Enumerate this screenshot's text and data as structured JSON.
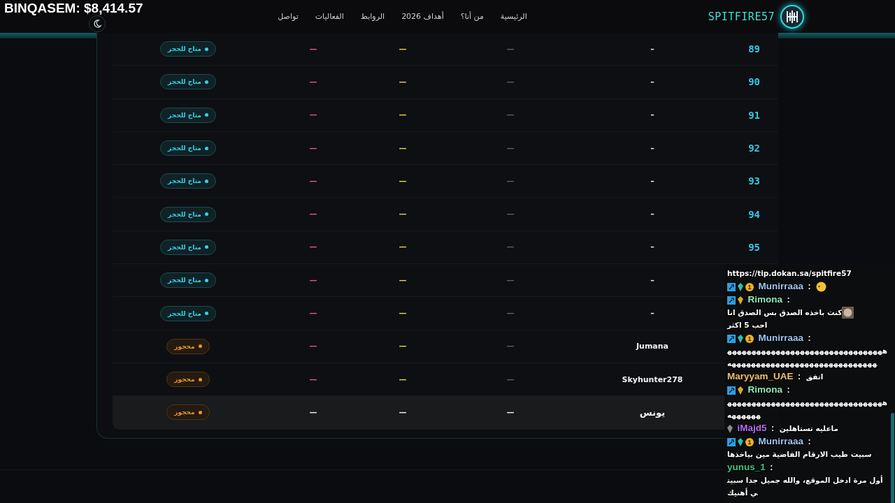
{
  "overlay": {
    "balance": "BINQASEM: $8,414.57"
  },
  "nav": {
    "brand": "SPITFIRE57",
    "links": [
      "الرئيسية",
      "من أنا؟",
      "أهداف 2026",
      "الروابط",
      "الفعاليات",
      "تواصل"
    ]
  },
  "table": {
    "rows": [
      {
        "number": "89",
        "name": "–",
        "cells": [
          "—",
          "—",
          "—"
        ],
        "status": {
          "kind": "available",
          "label": "متاح للحجز"
        },
        "hovered": false
      },
      {
        "number": "90",
        "name": "–",
        "cells": [
          "—",
          "—",
          "—"
        ],
        "status": {
          "kind": "available",
          "label": "متاح للحجز"
        },
        "hovered": false
      },
      {
        "number": "91",
        "name": "–",
        "cells": [
          "—",
          "—",
          "—"
        ],
        "status": {
          "kind": "available",
          "label": "متاح للحجز"
        },
        "hovered": false
      },
      {
        "number": "92",
        "name": "–",
        "cells": [
          "—",
          "—",
          "—"
        ],
        "status": {
          "kind": "available",
          "label": "متاح للحجز"
        },
        "hovered": false
      },
      {
        "number": "93",
        "name": "–",
        "cells": [
          "—",
          "—",
          "—"
        ],
        "status": {
          "kind": "available",
          "label": "متاح للحجز"
        },
        "hovered": false
      },
      {
        "number": "94",
        "name": "–",
        "cells": [
          "—",
          "—",
          "—"
        ],
        "status": {
          "kind": "available",
          "label": "متاح للحجز"
        },
        "hovered": false
      },
      {
        "number": "95",
        "name": "–",
        "cells": [
          "—",
          "—",
          "—"
        ],
        "status": {
          "kind": "available",
          "label": "متاح للحجز"
        },
        "hovered": false
      },
      {
        "name": "–",
        "cells": [
          "—",
          "—",
          "—"
        ],
        "status": {
          "kind": "available",
          "label": "متاح للحجز"
        },
        "hovered": false
      },
      {
        "name": "–",
        "cells": [
          "—",
          "—",
          "—"
        ],
        "status": {
          "kind": "available",
          "label": "متاح للحجز"
        },
        "hovered": false
      },
      {
        "name": "Jumana",
        "cells": [
          "—",
          "—",
          "—"
        ],
        "status": {
          "kind": "booked",
          "label": "محجوز"
        },
        "hovered": false
      },
      {
        "name": "Skyhunter278",
        "cells": [
          "—",
          "—",
          "—"
        ],
        "status": {
          "kind": "booked",
          "label": "محجوز"
        },
        "hovered": false
      },
      {
        "name": "يونس",
        "cells": [
          "—",
          "—",
          "—"
        ],
        "status": {
          "kind": "booked",
          "label": "محجوز"
        },
        "hovered": true
      }
    ]
  },
  "chat": {
    "messages": [
      {
        "parts": [
          {
            "kind": "text",
            "text": "https://tip.dokan.sa/spitfire57"
          }
        ]
      },
      {
        "user": "Munirraaa",
        "color": "#9cc4f0",
        "badges": [
          {
            "kind": "mod"
          },
          {
            "kind": "sub"
          },
          {
            "kind": "coin",
            "label": "1"
          }
        ],
        "separator": ":",
        "parts": [
          {
            "kind": "emoji"
          }
        ]
      },
      {
        "user": "Rimona",
        "color": "#8ee8b8",
        "badges": [
          {
            "kind": "mod"
          },
          {
            "kind": "gold"
          }
        ],
        "separator": ":",
        "parts": [
          {
            "kind": "text",
            "text": "كنت باخذه الصدق بس الصدق انا"
          },
          {
            "kind": "emote"
          },
          {
            "kind": "text",
            "text": "احب 5 اكثر"
          }
        ]
      },
      {
        "user": "Munirraaa",
        "color": "#9cc4f0",
        "badges": [
          {
            "kind": "mod"
          },
          {
            "kind": "sub"
          },
          {
            "kind": "coin",
            "label": "1"
          }
        ],
        "separator": ":",
        "parts": [
          {
            "kind": "text",
            "text": "هههههههههههههههههههههههههههههههههههههههههههههههههههههههههههههههه"
          }
        ]
      },
      {
        "user": "Maryyam_UAE",
        "color": "#f0c070",
        "separator": ":",
        "parts": [
          {
            "kind": "text",
            "text": "اتفق"
          }
        ]
      },
      {
        "user": "Rimona",
        "color": "#8ee8b8",
        "badges": [
          {
            "kind": "mod"
          },
          {
            "kind": "gold"
          }
        ],
        "separator": ":",
        "parts": [
          {
            "kind": "text",
            "text": "هههههههههههههههههههههههههههههههههههههههه"
          }
        ]
      },
      {
        "user": "iMajd5",
        "color": "#b46ef0",
        "badges": [
          {
            "kind": "grey"
          }
        ],
        "separator": ":",
        "parts": [
          {
            "kind": "text",
            "text": "ماعليه تستاهلين"
          }
        ]
      },
      {
        "user": "Munirraaa",
        "color": "#9cc4f0",
        "badges": [
          {
            "kind": "mod"
          },
          {
            "kind": "sub"
          },
          {
            "kind": "coin",
            "label": "1"
          }
        ],
        "separator": ":",
        "parts": [
          {
            "kind": "text",
            "text": "سبيت طيب الارقام الفاضية مين بياخذها"
          }
        ]
      },
      {
        "user": "yunus_1",
        "color": "#3cc47c",
        "separator": ":",
        "parts": [
          {
            "kind": "text",
            "text": "أول مرة ادخل الموقع، والله جميل جدا سبيتي أهنيك"
          }
        ]
      }
    ]
  }
}
